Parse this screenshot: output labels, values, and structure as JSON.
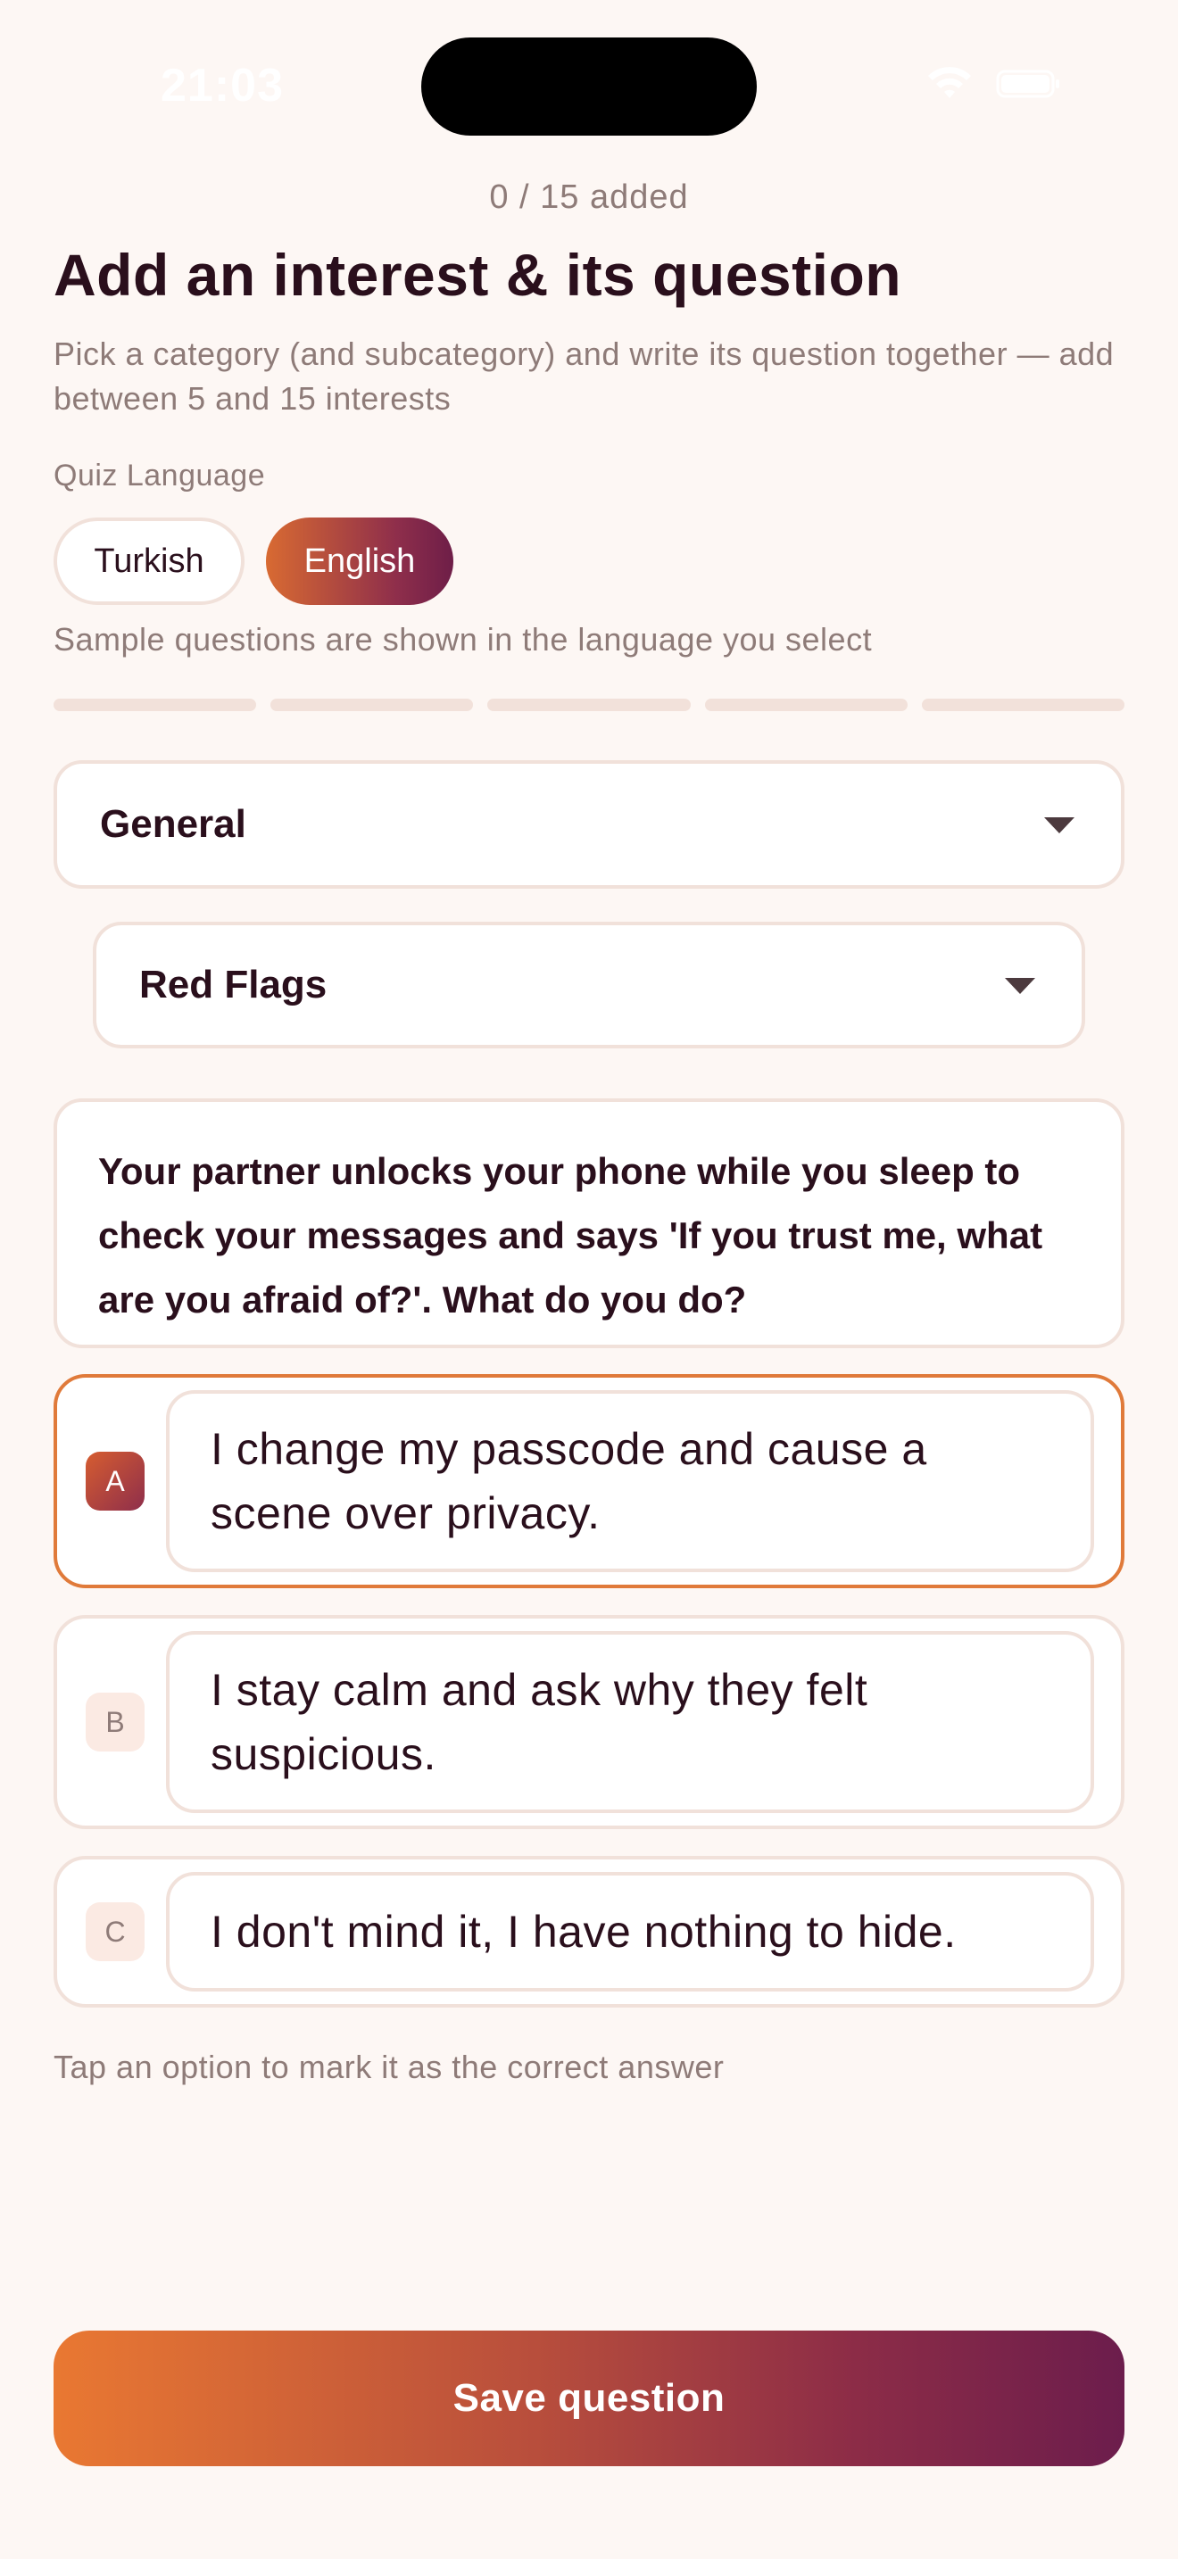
{
  "status_bar": {
    "time": "21:03",
    "wifi_icon": "wifi-icon",
    "battery_icon": "battery-icon"
  },
  "header": {
    "counter": "0 / 15 added",
    "title": "Add an interest & its question",
    "subtitle": "Pick a category (and subcategory) and write its question together — add between 5 and 15 interests"
  },
  "language": {
    "label": "Quiz Language",
    "options": [
      {
        "label": "Turkish",
        "selected": false
      },
      {
        "label": "English",
        "selected": true
      }
    ],
    "note": "Sample questions are shown in the language you select"
  },
  "progress": {
    "segments": 5,
    "filled": 0
  },
  "category": {
    "value": "General",
    "icon": "chevron-down-icon"
  },
  "subcategory": {
    "value": "Red Flags",
    "icon": "chevron-down-icon"
  },
  "question": {
    "text": "Your partner unlocks your phone while you sleep to check your messages and says 'If you trust me, what are you afraid of?'. What do you do?"
  },
  "options": [
    {
      "letter": "A",
      "text": "I change my passcode and cause a scene over privacy.",
      "selected": true
    },
    {
      "letter": "B",
      "text": "I stay calm and ask why they felt suspicious.",
      "selected": false
    },
    {
      "letter": "C",
      "text": "I don't mind it, I have nothing to hide.",
      "selected": false
    }
  ],
  "hint": "Tap an option to mark it as the correct answer",
  "save_button": {
    "label": "Save question"
  },
  "colors": {
    "background": "#FDF7F4",
    "accent_orange": "#E07A3A",
    "accent_plum": "#6C1D4C",
    "text_primary": "#2A0F1C",
    "text_muted": "#8E7B78",
    "border": "#F1E1DA"
  }
}
